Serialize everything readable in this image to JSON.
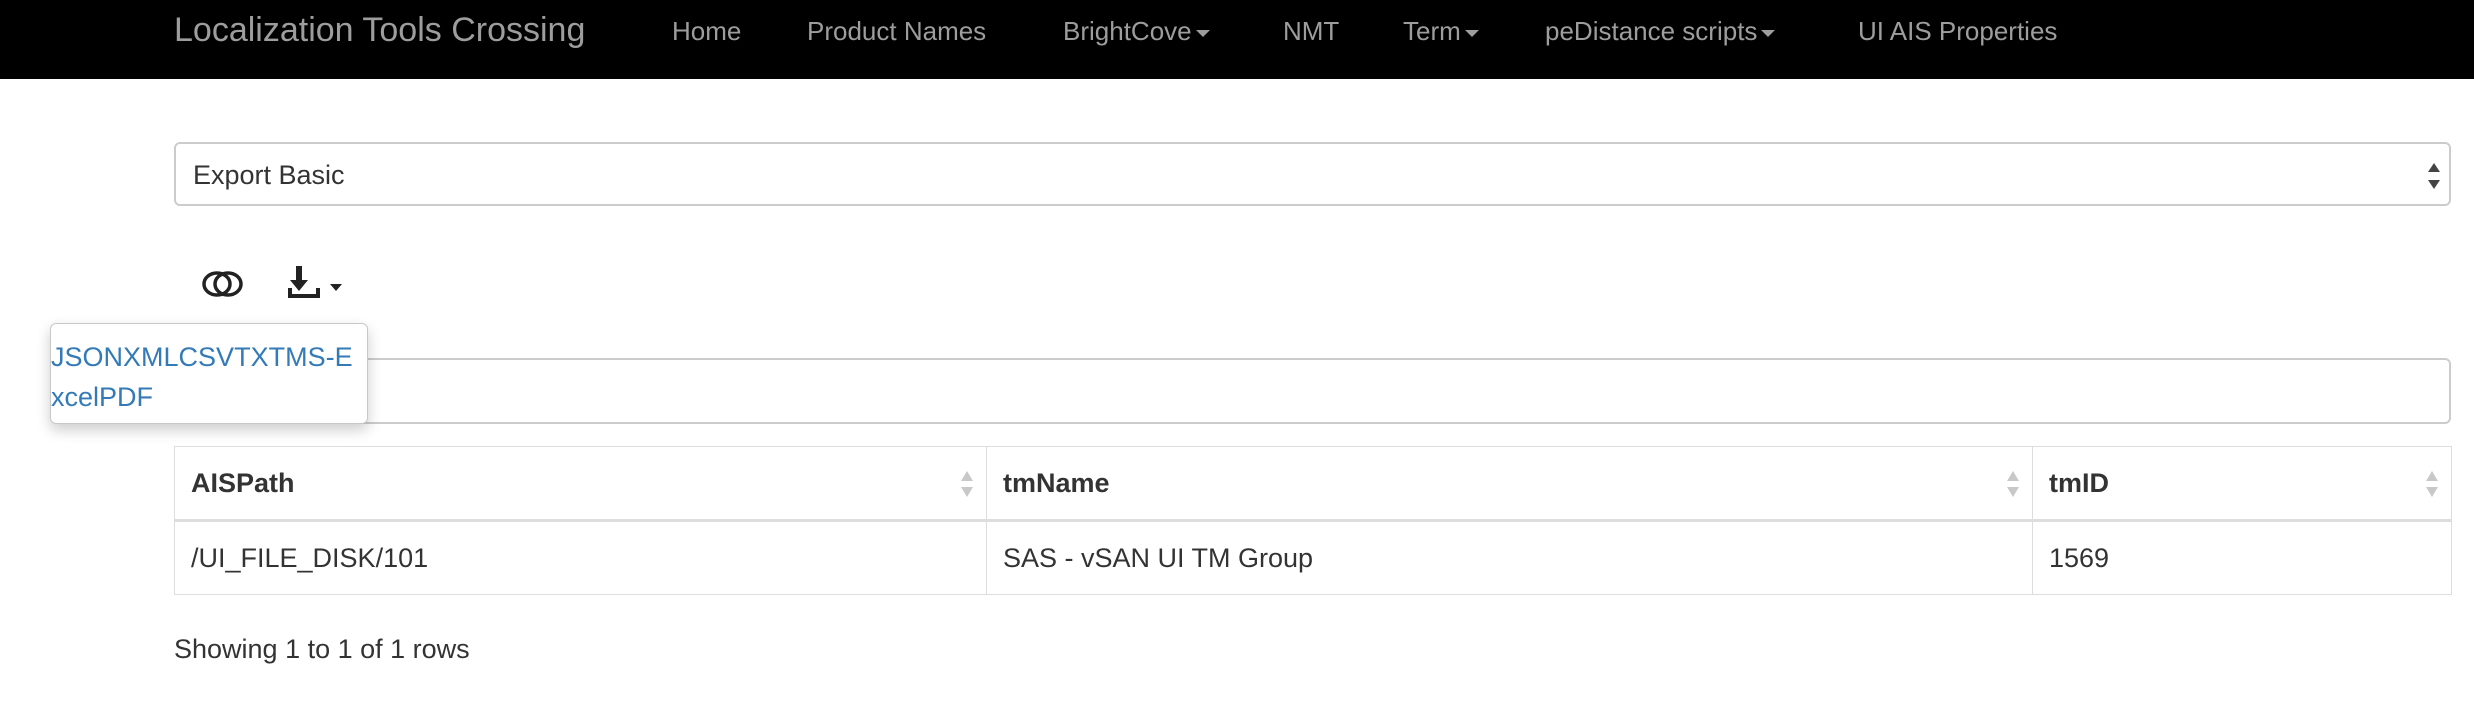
{
  "navbar": {
    "brand": "Localization Tools Crossing",
    "items": [
      {
        "label": "Home"
      },
      {
        "label": "Product Names"
      },
      {
        "label": "BrightCove"
      },
      {
        "label": "NMT"
      },
      {
        "label": "Term"
      },
      {
        "label": "peDistance scripts"
      },
      {
        "label": "UI AIS Properties"
      }
    ]
  },
  "export_select": {
    "selected": "Export Basic"
  },
  "toolbar": {
    "columns_toggle_icon": "toggle-icon",
    "export_icon": "download-icon"
  },
  "export_menu": {
    "options": [
      "JSON",
      "XML",
      "CSV",
      "TXT",
      "MS-Excel",
      "PDF"
    ]
  },
  "search": {
    "value": ""
  },
  "table": {
    "columns": [
      "AISPath",
      "tmName",
      "tmID"
    ],
    "rows": [
      [
        "/UI_FILE_DISK/101",
        "SAS - vSAN UI TM Group",
        "1569"
      ]
    ]
  },
  "pagination": {
    "info": "Showing 1 to 1 of 1 rows"
  },
  "colors": {
    "navbar_bg": "#000000",
    "nav_text": "#9d9d9d",
    "link": "#337ab7",
    "border": "#dddddd"
  }
}
